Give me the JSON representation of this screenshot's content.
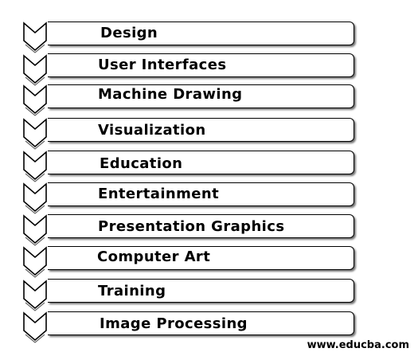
{
  "diagram": {
    "items": [
      {
        "label": "Design"
      },
      {
        "label": "User Interfaces"
      },
      {
        "label": "Machine Drawing"
      },
      {
        "label": "Visualization"
      },
      {
        "label": "Education"
      },
      {
        "label": "Entertainment"
      },
      {
        "label": "Presentation Graphics"
      },
      {
        "label": "Computer Art"
      },
      {
        "label": "Training"
      },
      {
        "label": "Image Processing"
      }
    ],
    "watermark": "www.educba.com"
  }
}
